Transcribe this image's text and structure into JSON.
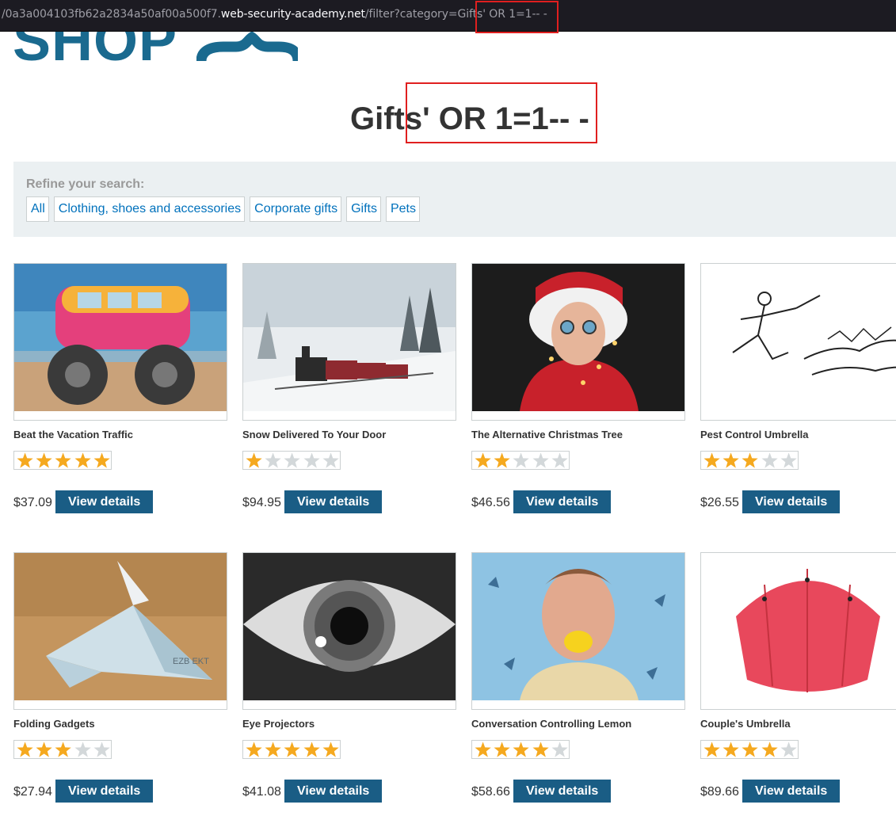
{
  "browser": {
    "url_prefix": "/0a3a004103fb62a2834a50af00a500f7.",
    "url_host": "web-security-academy.net",
    "url_path": "/filter?category=Gifts' OR 1=1-- -"
  },
  "header": {
    "logo_text": "SHOP"
  },
  "page_title": "Gifts' OR 1=1-- -",
  "filters": {
    "label": "Refine your search:",
    "items": [
      {
        "label": "All"
      },
      {
        "label": "Clothing, shoes and accessories"
      },
      {
        "label": "Corporate gifts"
      },
      {
        "label": "Gifts"
      },
      {
        "label": "Pets"
      }
    ]
  },
  "colors": {
    "brand": "#1a6a8f",
    "button": "#1a5d85",
    "link": "#0071bc",
    "star": "#f5a91f",
    "star_empty": "#d3d8da",
    "highlight": "#e01f1f"
  },
  "products": [
    {
      "name": "Beat the Vacation Traffic",
      "rating": 5,
      "price": "$37.09",
      "button": "View details",
      "image_icon": "monster-van-image"
    },
    {
      "name": "Snow Delivered To Your Door",
      "rating": 1,
      "price": "$94.95",
      "button": "View details",
      "image_icon": "snowy-train-image"
    },
    {
      "name": "The Alternative Christmas Tree",
      "rating": 2,
      "price": "$46.56",
      "button": "View details",
      "image_icon": "santa-lights-image"
    },
    {
      "name": "Pest Control Umbrella",
      "rating": 3,
      "price": "$26.55",
      "button": "View details",
      "image_icon": "umbrella-sketch-image"
    },
    {
      "name": "Folding Gadgets",
      "rating": 3,
      "price": "$27.94",
      "button": "View details",
      "image_icon": "paper-bird-image"
    },
    {
      "name": "Eye Projectors",
      "rating": 5,
      "price": "$41.08",
      "button": "View details",
      "image_icon": "eye-image"
    },
    {
      "name": "Conversation Controlling Lemon",
      "rating": 4,
      "price": "$58.66",
      "button": "View details",
      "image_icon": "lemon-man-image"
    },
    {
      "name": "Couple's Umbrella",
      "rating": 4,
      "price": "$89.66",
      "button": "View details",
      "image_icon": "red-umbrella-image"
    }
  ]
}
